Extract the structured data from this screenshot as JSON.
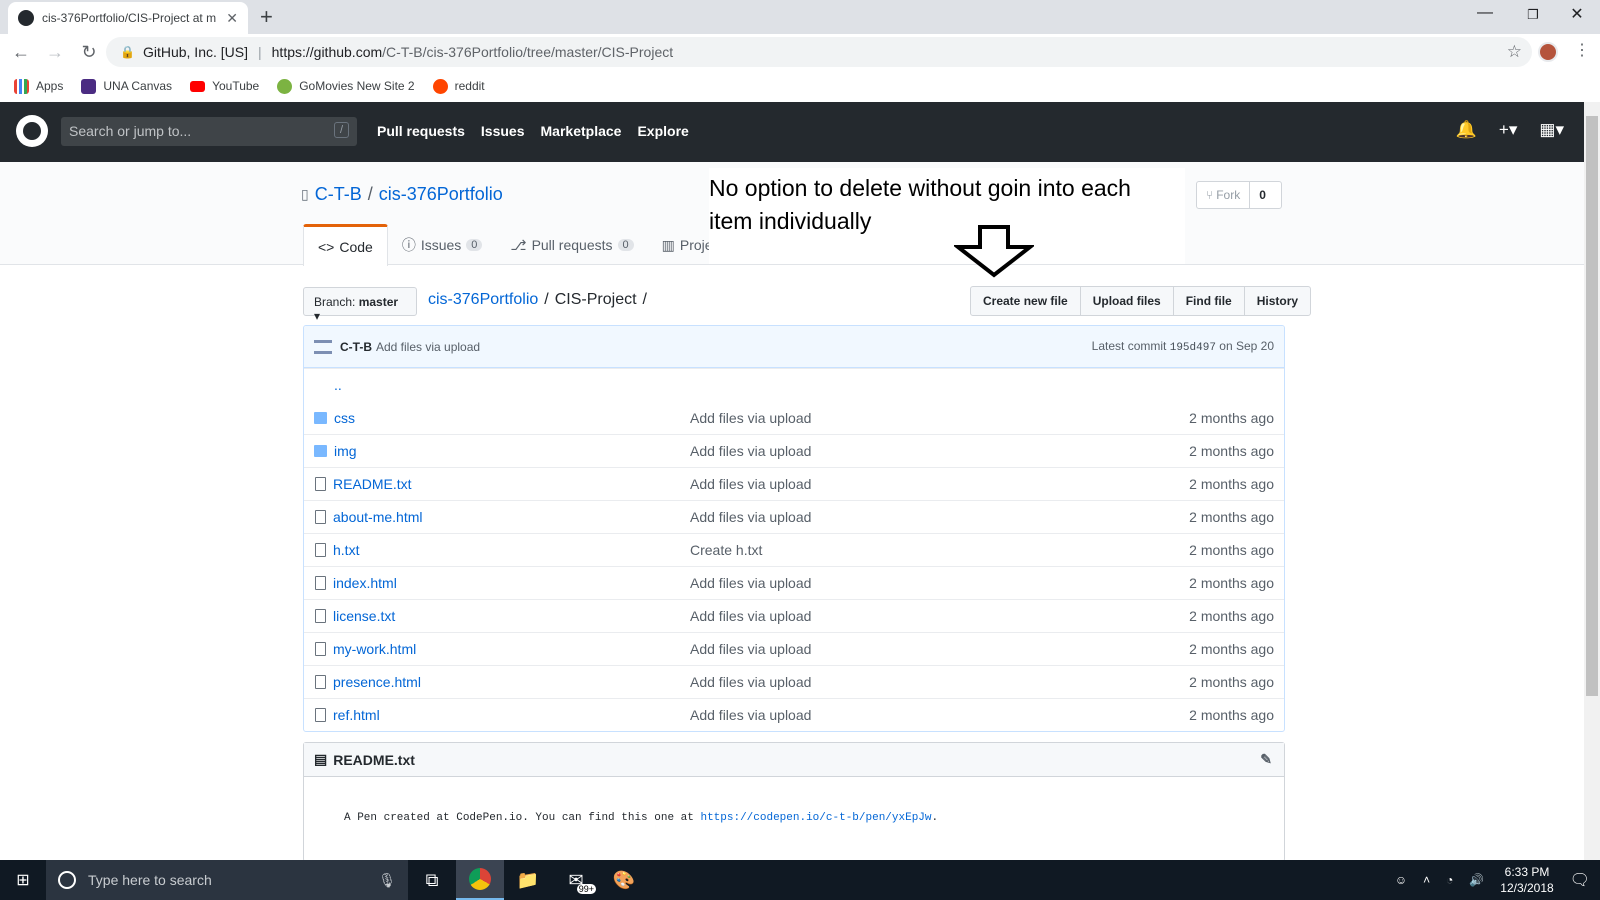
{
  "browser": {
    "tab_title": "cis-376Portfolio/CIS-Project at m",
    "url_org": "GitHub, Inc. [US]",
    "url_host": "https://github.com",
    "url_path": "/C-T-B/cis-376Portfolio/tree/master/CIS-Project",
    "bookmarks": [
      "Apps",
      "UNA Canvas",
      "YouTube",
      "GoMovies New Site 2",
      "reddit"
    ]
  },
  "github": {
    "search_placeholder": "Search or jump to...",
    "search_key": "/",
    "nav": [
      "Pull requests",
      "Issues",
      "Marketplace",
      "Explore"
    ]
  },
  "repo": {
    "owner": "C-T-B",
    "name": "cis-376Portfolio",
    "fork_label": "Fork",
    "fork_count": "0",
    "tabs": [
      {
        "label": "Code"
      },
      {
        "label": "Issues",
        "count": "0"
      },
      {
        "label": "Pull requests",
        "count": "0"
      },
      {
        "label": "Projec"
      }
    ],
    "branch_prefix": "Branch:",
    "branch": "master",
    "breadcrumb_root": "cis-376Portfolio",
    "breadcrumb_dir": "CIS-Project",
    "file_buttons": [
      "Create new file",
      "Upload files",
      "Find file",
      "History"
    ]
  },
  "annotation": {
    "line1": "No option to delete without goin into each",
    "line2": "item individually"
  },
  "commit": {
    "author": "C-T-B",
    "message": "Add files via upload",
    "latest_label": "Latest commit",
    "sha": "195d497",
    "date": "on Sep 20"
  },
  "files": [
    {
      "name": "css",
      "type": "dir",
      "message": "Add files via upload",
      "age": "2 months ago"
    },
    {
      "name": "img",
      "type": "dir",
      "message": "Add files via upload",
      "age": "2 months ago"
    },
    {
      "name": "README.txt",
      "type": "file",
      "message": "Add files via upload",
      "age": "2 months ago"
    },
    {
      "name": "about-me.html",
      "type": "file",
      "message": "Add files via upload",
      "age": "2 months ago"
    },
    {
      "name": "h.txt",
      "type": "file",
      "message": "Create h.txt",
      "age": "2 months ago"
    },
    {
      "name": "index.html",
      "type": "file",
      "message": "Add files via upload",
      "age": "2 months ago"
    },
    {
      "name": "license.txt",
      "type": "file",
      "message": "Add files via upload",
      "age": "2 months ago"
    },
    {
      "name": "my-work.html",
      "type": "file",
      "message": "Add files via upload",
      "age": "2 months ago"
    },
    {
      "name": "presence.html",
      "type": "file",
      "message": "Add files via upload",
      "age": "2 months ago"
    },
    {
      "name": "ref.html",
      "type": "file",
      "message": "Add files via upload",
      "age": "2 months ago"
    }
  ],
  "readme": {
    "title": "README.txt",
    "text": "A Pen created at CodePen.io. You can find this one at",
    "link": "https://codepen.io/c-t-b/pen/yxEpJw",
    "end": "."
  },
  "taskbar": {
    "search_placeholder": "Type here to search",
    "badge": "99+",
    "time": "6:33 PM",
    "date": "12/3/2018"
  }
}
